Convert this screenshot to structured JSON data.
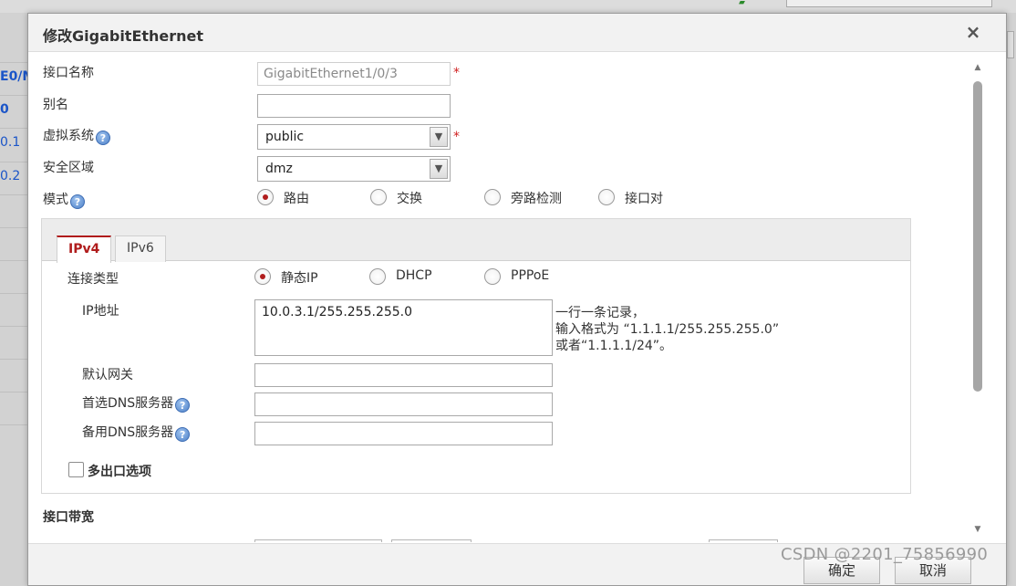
{
  "background": {
    "left_links": [
      "E0/M",
      "0",
      "0.1",
      "0.2"
    ]
  },
  "dialog": {
    "title": "修改GigabitEthernet",
    "close_symbol": "×"
  },
  "form": {
    "interface_name": {
      "label": "接口名称",
      "value": "GigabitEthernet1/0/3",
      "required_mark": "*"
    },
    "alias": {
      "label": "别名",
      "value": ""
    },
    "virtual_system": {
      "label": "虚拟系统",
      "value": "public",
      "required_mark": "*"
    },
    "security_zone": {
      "label": "安全区域",
      "value": "dmz"
    },
    "mode": {
      "label": "模式",
      "options": [
        "路由",
        "交换",
        "旁路检测",
        "接口对"
      ],
      "selected": "路由"
    }
  },
  "ip_panel": {
    "tabs": [
      {
        "label": "IPv4",
        "active": true
      },
      {
        "label": "IPv6",
        "active": false
      }
    ],
    "connection_type": {
      "label": "连接类型",
      "options": [
        "静态IP",
        "DHCP",
        "PPPoE"
      ],
      "selected": "静态IP"
    },
    "ip_address": {
      "label": "IP地址",
      "value": "10.0.3.1/255.255.255.0",
      "hint": [
        "一行一条记录，",
        "输入格式为 “1.1.1.1/255.255.255.0”",
        "或者“1.1.1.1/24”。"
      ]
    },
    "default_gateway": {
      "label": "默认网关",
      "value": ""
    },
    "primary_dns": {
      "label": "首选DNS服务器",
      "value": ""
    },
    "secondary_dns": {
      "label": "备用DNS服务器",
      "value": ""
    },
    "multi_egress": {
      "label": "多出口选项",
      "checked": false
    }
  },
  "bandwidth": {
    "section_label": "接口带宽"
  },
  "footer": {
    "ok_label": "确定",
    "cancel_label": "取消"
  },
  "watermark": "CSDN @2201_75856990",
  "colors": {
    "accent": "#b01c1c",
    "link": "#1b55c8",
    "required": "#d02020"
  }
}
